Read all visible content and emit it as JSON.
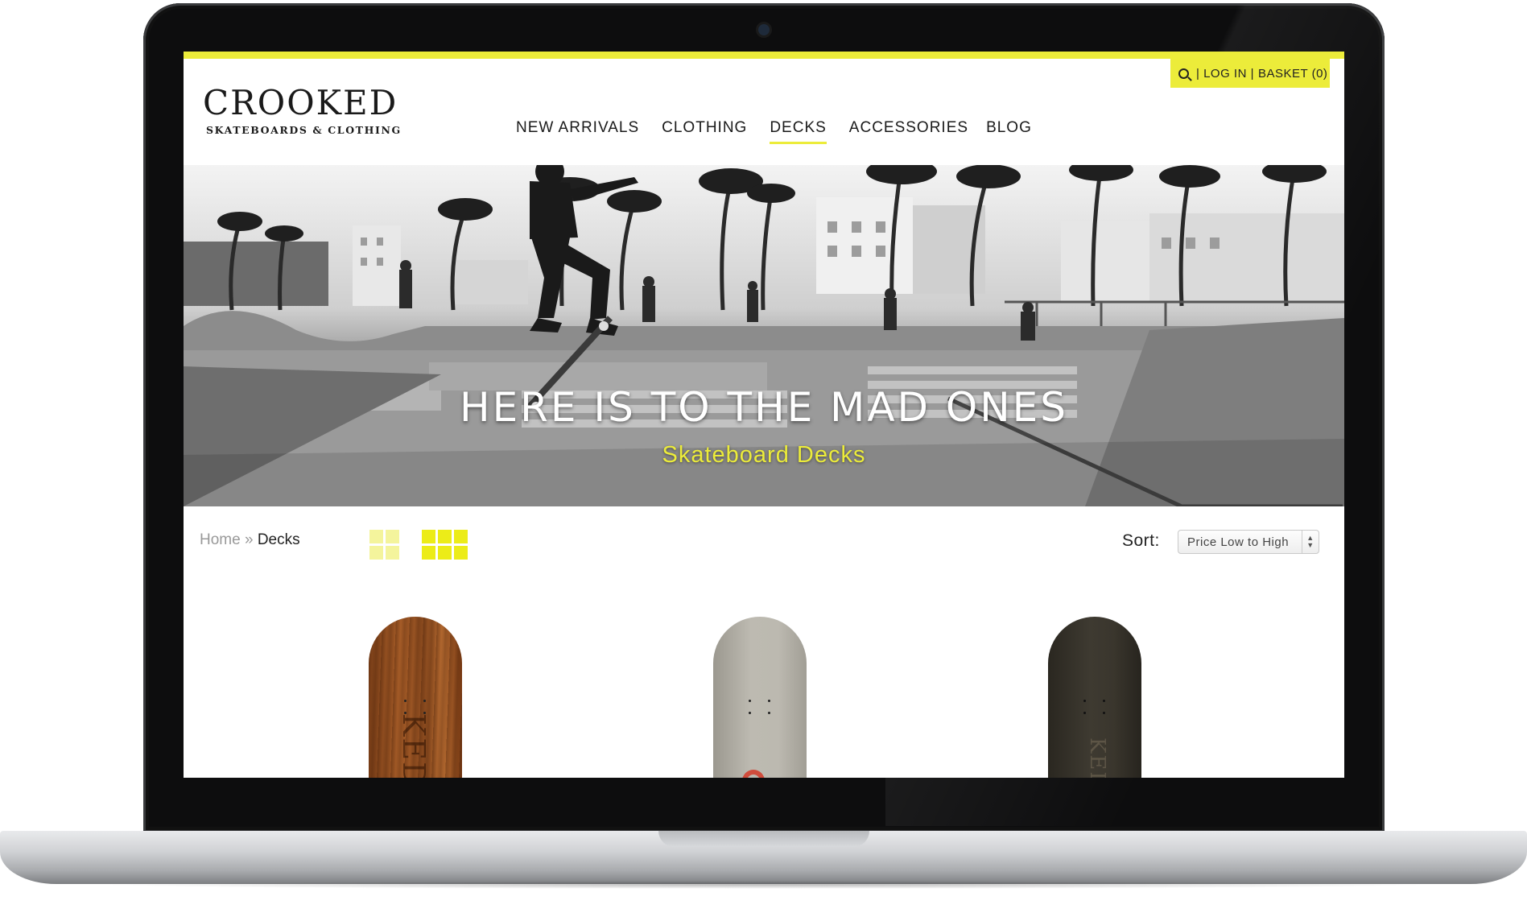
{
  "site": {
    "logo_main": "CROOKED",
    "logo_sub": "SKATEBOARDS & CLOTHING"
  },
  "utility": {
    "login": "| LOG IN |",
    "basket": "BASKET (0)"
  },
  "nav": {
    "items": [
      {
        "label": "NEW ARRIVALS"
      },
      {
        "label": "CLOTHING"
      },
      {
        "label": "DECKS",
        "active": true
      },
      {
        "label": "ACCESSORIES"
      },
      {
        "label": "BLOG"
      }
    ]
  },
  "hero": {
    "title": "HERE IS TO THE MAD ONES",
    "subtitle": "Skateboard Decks"
  },
  "breadcrumb": {
    "home": "Home",
    "separator": " » ",
    "current": "Decks"
  },
  "sort": {
    "label": "Sort:",
    "selected": "Price Low to High"
  },
  "decks": {
    "brand_text": "KED"
  },
  "colors": {
    "accent": "#ecec3a",
    "text": "#1a1a1a"
  }
}
